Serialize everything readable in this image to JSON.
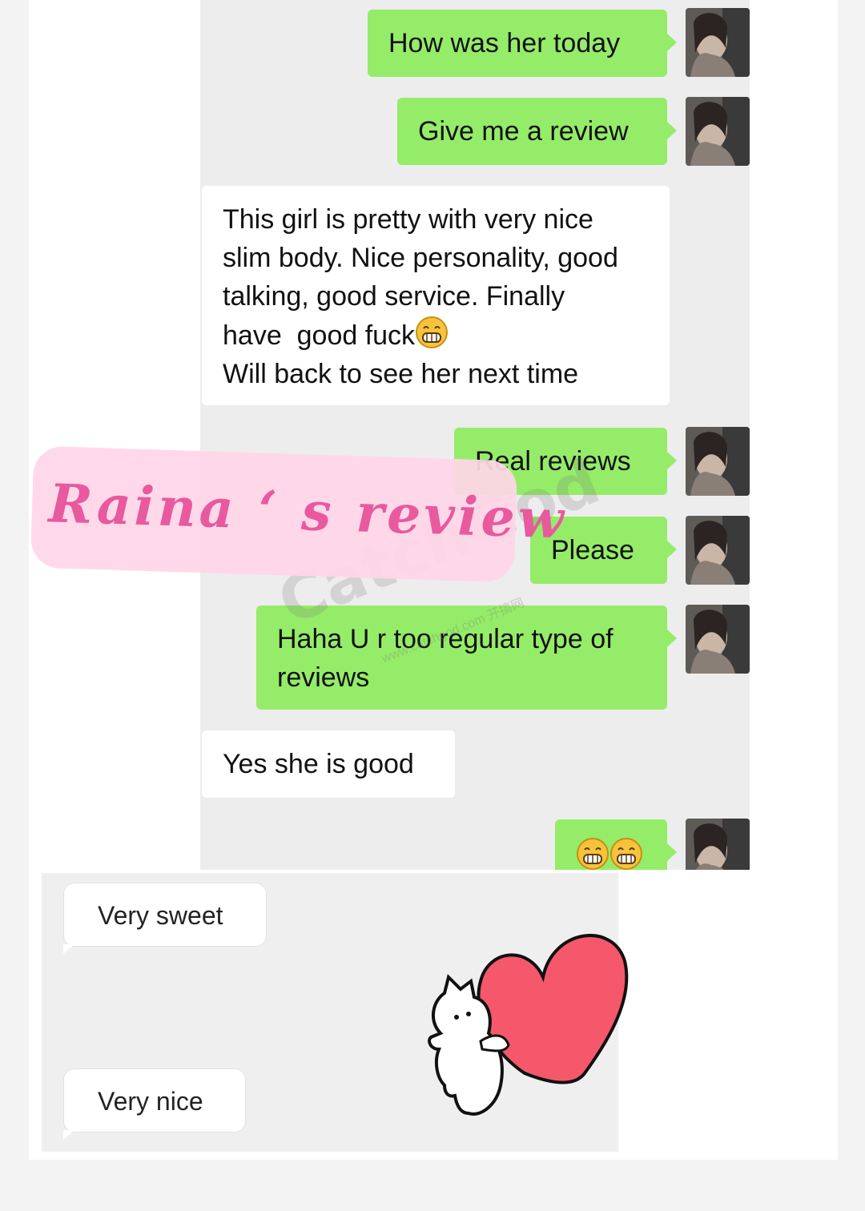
{
  "chat": {
    "messages": [
      {
        "side": "out",
        "text": "How was her today"
      },
      {
        "side": "out",
        "text": "Give me a review"
      },
      {
        "side": "in",
        "lines": [
          "This girl is pretty with very nice",
          "slim body. Nice personality, good",
          "talking, good service. Finally",
          "have  good fuck",
          "Will back to see her next time"
        ],
        "emoji": "grinning-face-emoji"
      },
      {
        "side": "out",
        "text": "Real reviews"
      },
      {
        "side": "out",
        "text": "Please"
      },
      {
        "side": "out",
        "lines": [
          "Haha U r too regular type of",
          "reviews"
        ]
      },
      {
        "side": "in",
        "text": "Yes she is good"
      },
      {
        "side": "out",
        "emoji_count": 2,
        "emoji": "grinning-face-emoji"
      }
    ]
  },
  "sticker_panel": {
    "bubbles": [
      "Very sweet",
      "Very nice"
    ],
    "sticker": "cat-holding-heart"
  },
  "overlay_label": "Raina ‘ s review",
  "watermark": {
    "main": "CatchGod",
    "sub": "www.catchgod.com 开搞网"
  },
  "colors": {
    "outgoing_bubble": "#95ec69",
    "incoming_bubble": "#ffffff",
    "label_pink": "#e8599d",
    "label_bg": "#ffd6e8",
    "heart": "#f4586a"
  }
}
